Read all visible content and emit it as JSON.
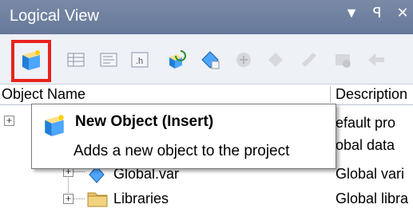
{
  "panel": {
    "title": "Logical View",
    "buttons": [
      "▼",
      "ꟼ",
      "✕"
    ]
  },
  "toolbar": {
    "tools": [
      {
        "icon": "new-object-icon"
      },
      {
        "icon": "table-icon"
      },
      {
        "icon": "form-icon"
      },
      {
        "icon": "header-file-icon",
        "label": ".h"
      },
      {
        "icon": "refresh-objects-icon"
      },
      {
        "icon": "edit-object-icon"
      },
      {
        "icon": "disabled-tool-icon"
      },
      {
        "icon": "disabled-tool-icon"
      },
      {
        "icon": "disabled-tool-icon"
      },
      {
        "icon": "disabled-tool-icon"
      },
      {
        "icon": "disabled-tool-icon"
      }
    ]
  },
  "columns": {
    "object_name": "Object Name",
    "description": "Description"
  },
  "rows": [
    {
      "name": "",
      "desc": "efault pro"
    },
    {
      "name": "",
      "desc": "obal data"
    },
    {
      "name": "Global.var",
      "desc": "Global vari"
    },
    {
      "name": "Libraries",
      "desc": "Global libra"
    }
  ],
  "tooltip": {
    "title": "New Object  (Insert)",
    "description": "Adds a new object to the project"
  },
  "colors": {
    "titlebar": "#6d7f9f",
    "highlight_frame": "#e8231c",
    "folder": "#e9c46a"
  }
}
